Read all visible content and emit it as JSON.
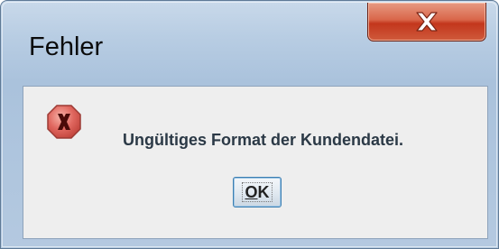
{
  "window": {
    "title": "Fehler"
  },
  "titlebar": {
    "close_icon": "close-icon"
  },
  "dialog": {
    "icon": "error-icon",
    "message": "Ungültiges Format der Kundendatei.",
    "ok_button": {
      "mnemonic": "O",
      "rest": "K"
    }
  },
  "colors": {
    "close_button": "#c3361c",
    "error_icon": "#e0675f",
    "message_text": "#2b3946"
  }
}
